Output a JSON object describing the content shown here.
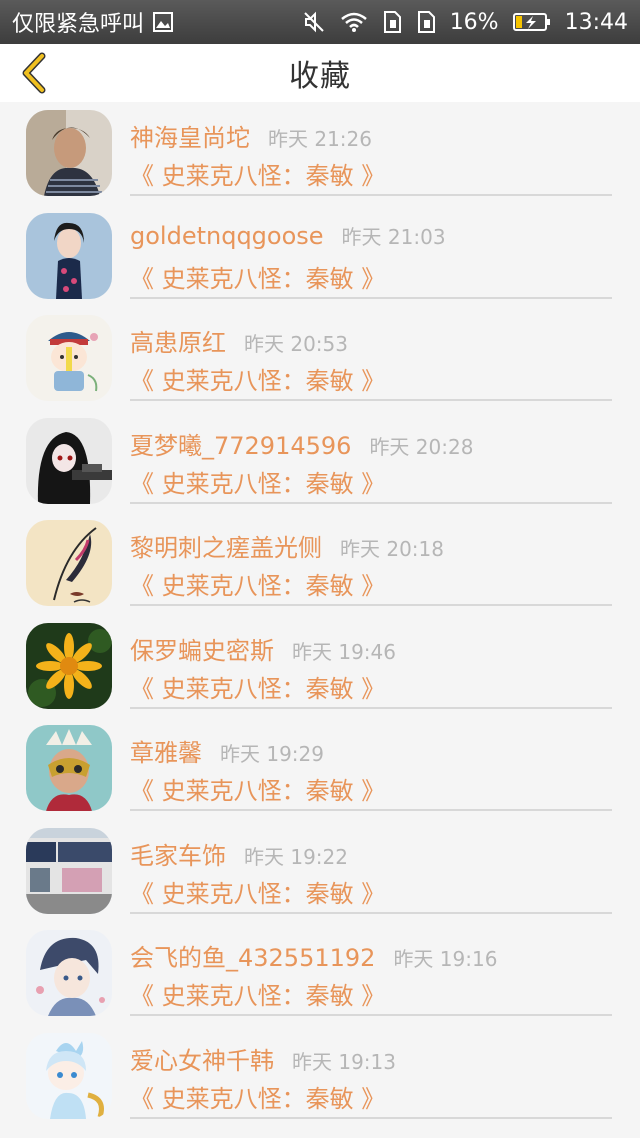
{
  "status_bar": {
    "carrier": "仅限紧急呼叫",
    "battery": "16%",
    "time": "13:44"
  },
  "header": {
    "title": "收藏",
    "back_icon": "chevron-left-icon",
    "accent": "#f0c020"
  },
  "colors": {
    "name": "#e8955a",
    "time": "#b6b6b6",
    "divider": "#d8d8d8"
  },
  "items": [
    {
      "name": "神海皇尚坨",
      "time": "昨天 21:26",
      "book": "《 史莱克八怪：秦敏 》"
    },
    {
      "name": "goldetnqqgoose",
      "time": "昨天 21:03",
      "book": "《 史莱克八怪：秦敏 》"
    },
    {
      "name": "高患原红",
      "time": "昨天 20:53",
      "book": "《 史莱克八怪：秦敏 》"
    },
    {
      "name": "夏梦曦_772914596",
      "time": "昨天 20:28",
      "book": "《 史莱克八怪：秦敏 》"
    },
    {
      "name": "黎明刺之瘥盖光侧",
      "time": "昨天 20:18",
      "book": "《 史莱克八怪：秦敏 》"
    },
    {
      "name": "保罗蝙史密斯",
      "time": "昨天 19:46",
      "book": "《 史莱克八怪：秦敏 》"
    },
    {
      "name": "章雅馨",
      "time": "昨天 19:29",
      "book": "《 史莱克八怪：秦敏 》"
    },
    {
      "name": "毛家车饰",
      "time": "昨天 19:22",
      "book": "《 史莱克八怪：秦敏 》"
    },
    {
      "name": "会飞的鱼_432551192",
      "time": "昨天 19:16",
      "book": "《 史莱克八怪：秦敏 》"
    },
    {
      "name": "爱心女神千韩",
      "time": "昨天 19:13",
      "book": "《 史莱克八怪：秦敏 》"
    }
  ]
}
